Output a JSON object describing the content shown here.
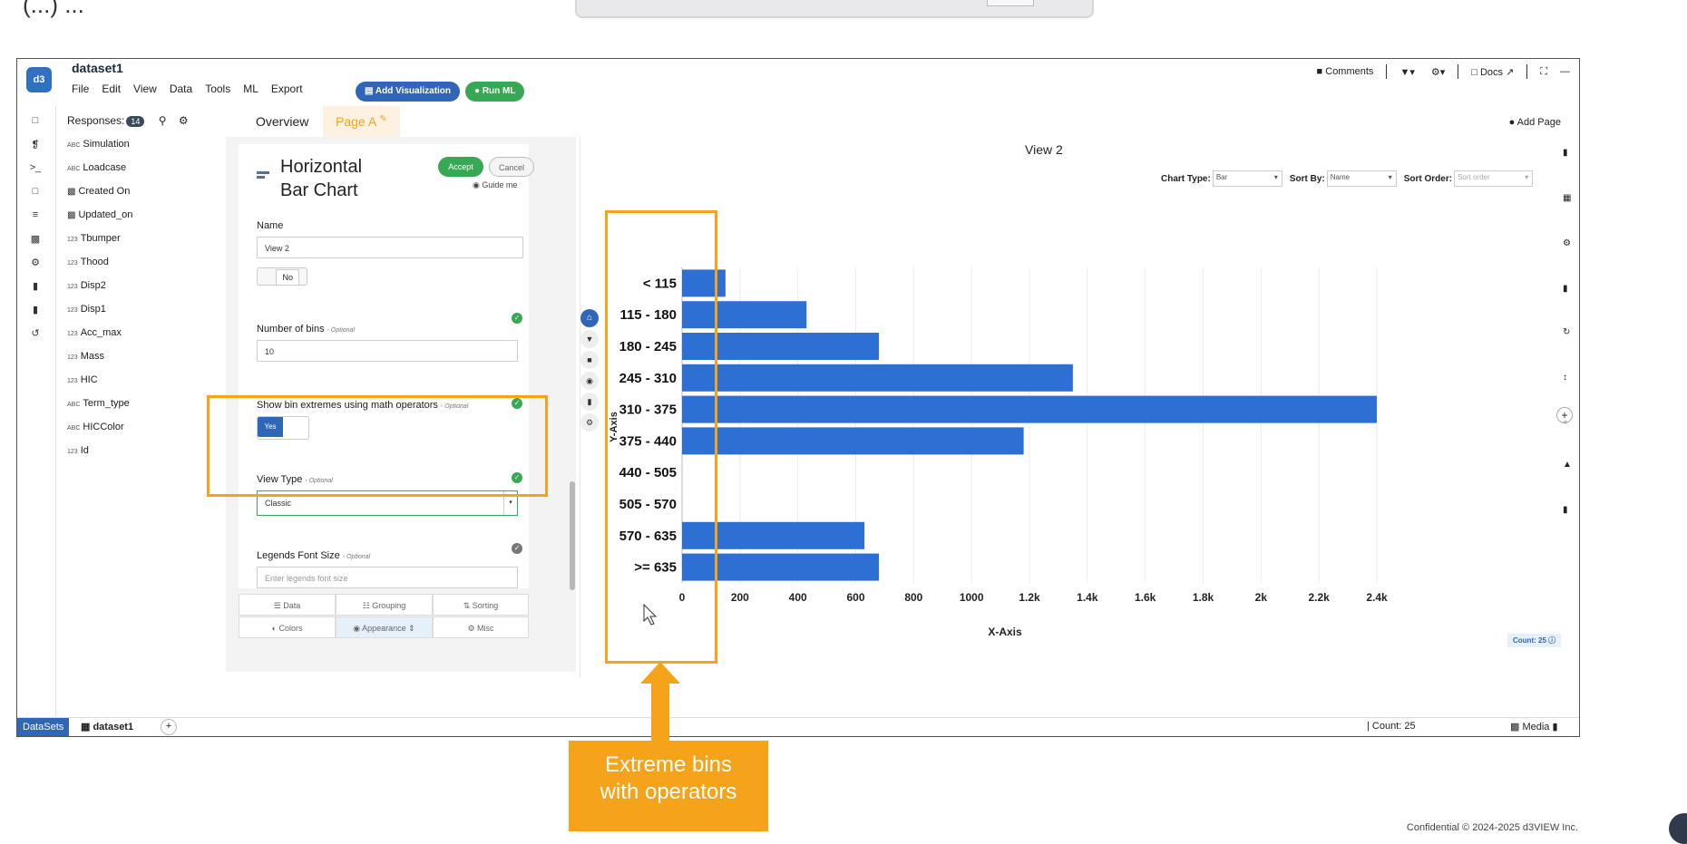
{
  "top_text": "(...) ...",
  "header": {
    "title": "dataset1",
    "menu": [
      "File",
      "Edit",
      "View",
      "Data",
      "Tools",
      "ML",
      "Export"
    ],
    "add_visualization": "Add Visualization",
    "run_ml": "Run ML",
    "comments": "Comments",
    "docs": "Docs"
  },
  "fields_panel": {
    "responses_label": "Responses:",
    "responses_count": "14",
    "fields": [
      {
        "type": "ABC",
        "name": "Simulation"
      },
      {
        "type": "ABC",
        "name": "Loadcase"
      },
      {
        "type": "cal",
        "name": "Created On"
      },
      {
        "type": "cal",
        "name": "Updated_on"
      },
      {
        "type": "123",
        "name": "Tbumper"
      },
      {
        "type": "123",
        "name": "Thood"
      },
      {
        "type": "123",
        "name": "Disp2"
      },
      {
        "type": "123",
        "name": "Disp1"
      },
      {
        "type": "123",
        "name": "Acc_max"
      },
      {
        "type": "123",
        "name": "Mass"
      },
      {
        "type": "123",
        "name": "HIC"
      },
      {
        "type": "ABC",
        "name": "Term_type"
      },
      {
        "type": "ABC",
        "name": "HICColor"
      },
      {
        "type": "123",
        "name": "Id"
      }
    ]
  },
  "tabs": {
    "overview": "Overview",
    "page_a": "Page A",
    "add_page": "Add Page"
  },
  "editor": {
    "title_line1": "Horizontal",
    "title_line2": "Bar Chart",
    "accept": "Accept",
    "cancel": "Cancel",
    "guide": "Guide me",
    "name_label": "Name",
    "name_value": "View 2",
    "toggle_no": "No",
    "bins_label": "Number of bins",
    "optional": "- Optional",
    "bins_value": "10",
    "extremes_label": "Show bin extremes using math operators",
    "toggle_yes": "Yes",
    "view_type_label": "View Type",
    "view_type_value": "Classic",
    "legends_label": "Legends Font Size",
    "legends_placeholder": "Enter legends font size",
    "bottom_tabs": [
      "Data",
      "Grouping",
      "Sorting",
      "Colors",
      "Appearance",
      "Misc"
    ]
  },
  "chart_controls": {
    "chart_type_label": "Chart Type:",
    "chart_type_value": "Bar",
    "sort_by_label": "Sort By:",
    "sort_by_value": "Name",
    "sort_order_label": "Sort Order:",
    "sort_order_placeholder": "Sort order",
    "count_badge": "Count: 25"
  },
  "chart_data": {
    "type": "bar",
    "orientation": "horizontal",
    "title": "View 2",
    "xlabel": "X-Axis",
    "ylabel": "Y-Axis",
    "categories": [
      "< 115",
      "115 - 180",
      "180 - 245",
      "245 - 310",
      "310 - 375",
      "375 - 440",
      "440 - 505",
      "505 - 570",
      "570 - 635",
      ">= 635"
    ],
    "values": [
      150,
      430,
      680,
      1350,
      2400,
      1180,
      0,
      0,
      630,
      680
    ],
    "xlim": [
      0,
      2400
    ],
    "xticks": [
      "0",
      "200",
      "400",
      "600",
      "800",
      "1000",
      "1.2k",
      "1.4k",
      "1.6k",
      "1.8k",
      "2k",
      "2.2k",
      "2.4k"
    ],
    "bar_color": "#2e6fd3",
    "grid": true
  },
  "bottom_bar": {
    "datasets": "DataSets",
    "dataset_tab": "dataset1",
    "count": "Count: 25",
    "media": "Media"
  },
  "annotation": {
    "line1": "Extreme bins",
    "line2": "with operators",
    "color": "#f5a31a"
  },
  "footer": "Confidential © 2024-2025 d3VIEW Inc."
}
